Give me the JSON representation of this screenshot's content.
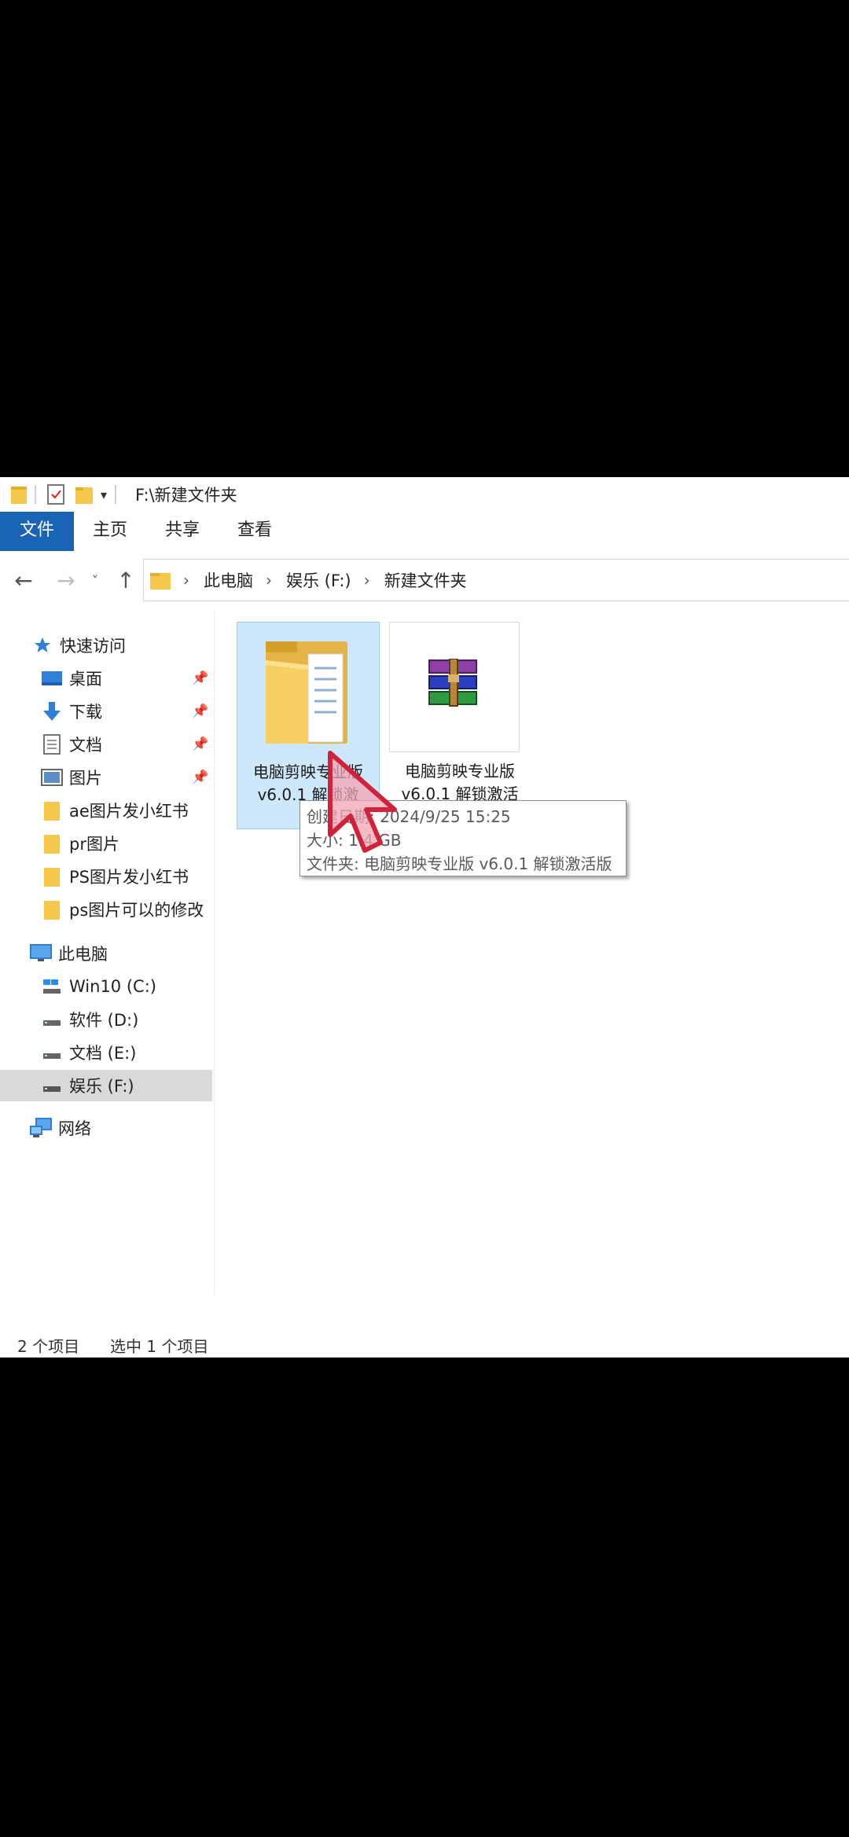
{
  "title_bar": {
    "path_title": "F:\\新建文件夹"
  },
  "ribbon": {
    "tabs": [
      "文件",
      "主页",
      "共享",
      "查看"
    ]
  },
  "address": {
    "crumbs": [
      "此电脑",
      "娱乐 (F:)",
      "新建文件夹"
    ]
  },
  "sidebar": {
    "quick_access": "快速访问",
    "pinned": [
      "桌面",
      "下载",
      "文档",
      "图片"
    ],
    "folders": [
      "ae图片发小红书",
      "pr图片",
      "PS图片发小红书",
      "ps图片可以的修改"
    ],
    "this_pc": "此电脑",
    "drives": [
      "Win10 (C:)",
      "软件 (D:)",
      "文档 (E:)",
      "娱乐 (F:)"
    ],
    "network": "网络"
  },
  "files": [
    {
      "name_line1": "电脑剪映专业版",
      "name_line2": "v6.0.1 解锁激",
      "type": "folder",
      "selected": true
    },
    {
      "name_line1": "电脑剪映专业版",
      "name_line2": "v6.0.1 解锁激活",
      "type": "archive",
      "selected": false
    }
  ],
  "tooltip": {
    "created": "创建日期: 2024/9/25 15:25",
    "size": "大小: 1.4 GB",
    "folder": "文件夹: 电脑剪映专业版 v6.0.1 解锁激活版"
  },
  "status": {
    "count": "2 个项目",
    "selected": "选中 1 个项目"
  },
  "colors": {
    "accent": "#1a64b6",
    "selection": "#cde7fb",
    "folder": "#f5c84d"
  }
}
